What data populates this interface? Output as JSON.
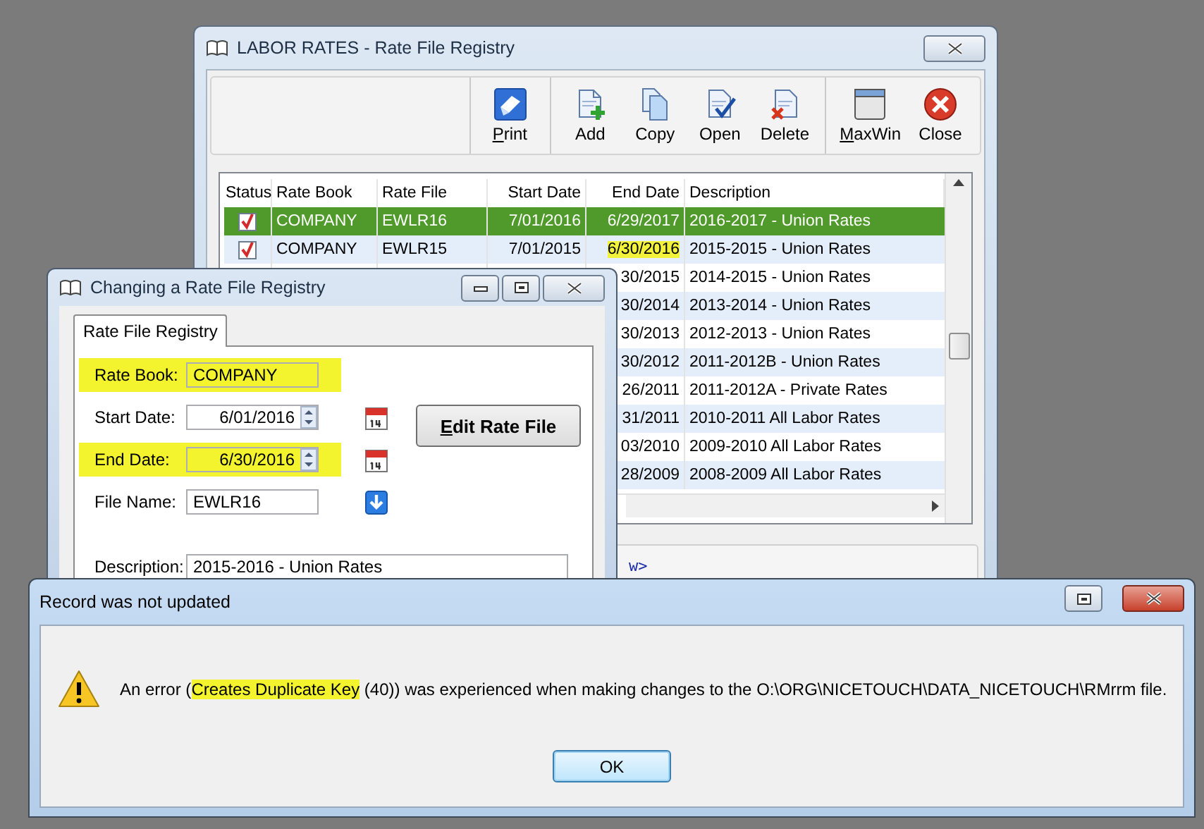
{
  "main_window": {
    "title": "LABOR RATES - Rate File Registry",
    "toolbar": [
      [
        {
          "label": "Print",
          "kind": "print",
          "mnemonic": true
        }
      ],
      [
        {
          "label": "Add",
          "kind": "add",
          "mnemonic": false
        },
        {
          "label": "Copy",
          "kind": "copy",
          "mnemonic": false
        },
        {
          "label": "Open",
          "kind": "open",
          "mnemonic": false
        },
        {
          "label": "Delete",
          "kind": "delete",
          "mnemonic": false
        }
      ],
      [
        {
          "label": "MaxWin",
          "kind": "maxwin",
          "mnemonic": true
        },
        {
          "label": "Close",
          "kind": "close",
          "mnemonic": false
        }
      ]
    ],
    "table": {
      "columns": [
        {
          "label": "Status",
          "kind": "status"
        },
        {
          "label": "Rate Book",
          "kind": "text"
        },
        {
          "label": "Rate File",
          "kind": "text"
        },
        {
          "label": "Start Date",
          "kind": "date"
        },
        {
          "label": "End Date",
          "kind": "date"
        },
        {
          "label": "Description",
          "kind": "text"
        }
      ],
      "rows": [
        {
          "selected": true,
          "checked": true,
          "rate_book": "COMPANY",
          "rate_file": "EWLR16",
          "start_date": "7/01/2016",
          "end_date": "6/29/2017",
          "end_date_highlighted": false,
          "description": "2016-2017 - Union Rates"
        },
        {
          "selected": false,
          "checked": true,
          "rate_book": "COMPANY",
          "rate_file": "EWLR15",
          "start_date": "7/01/2015",
          "end_date": "6/30/2016",
          "end_date_highlighted": true,
          "description": "2015-2015 - Union Rates"
        },
        {
          "selected": false,
          "end_date": "30/2015",
          "end_date_highlighted": false,
          "description": "2014-2015 - Union Rates"
        },
        {
          "selected": false,
          "end_date": "30/2014",
          "end_date_highlighted": false,
          "description": "2013-2014 - Union Rates"
        },
        {
          "selected": false,
          "end_date": "30/2013",
          "end_date_highlighted": false,
          "description": "2012-2013 - Union Rates"
        },
        {
          "selected": false,
          "end_date": "30/2012",
          "end_date_highlighted": false,
          "description": "2011-2012B - Union Rates"
        },
        {
          "selected": false,
          "end_date": "26/2011",
          "end_date_highlighted": false,
          "description": "2011-2012A - Private Rates"
        },
        {
          "selected": false,
          "end_date": "31/2011",
          "end_date_highlighted": false,
          "description": "2010-2011 All Labor Rates"
        },
        {
          "selected": false,
          "end_date": "03/2010",
          "end_date_highlighted": false,
          "description": "2009-2010 All Labor Rates"
        },
        {
          "selected": false,
          "end_date": "28/2009",
          "end_date_highlighted": false,
          "description": "2008-2009 All Labor Rates"
        }
      ]
    },
    "bottom_panel_text": "w>"
  },
  "edit_dialog": {
    "title": "Changing a Rate File Registry",
    "tabs": [
      {
        "label": "Rate File Registry",
        "selected": true
      }
    ],
    "fields": [
      {
        "label": "Rate Book:",
        "value": "COMPANY",
        "kind": "text",
        "highlighted": true
      },
      {
        "label": "Start Date:",
        "value": "6/01/2016",
        "kind": "date",
        "highlighted": false
      },
      {
        "label": "End Date:",
        "value": "6/30/2016",
        "kind": "date",
        "highlighted": true
      },
      {
        "label": "File Name:",
        "value": "EWLR16",
        "kind": "file",
        "highlighted": false
      },
      {
        "label": "Description:",
        "value": "2015-2016 - Union Rates",
        "kind": "wide",
        "highlighted": false
      }
    ],
    "button": {
      "label": "Edit Rate File",
      "mnemonic": true
    }
  },
  "message_box": {
    "title": "Record was not updated",
    "message": [
      {
        "text": "An error (",
        "highlighted": false
      },
      {
        "text": "Creates Duplicate Key",
        "highlighted": true
      },
      {
        "text": " (40)) was experienced when making changes to the O:\\ORG\\NICETOUCH\\DATA_NICETOUCH\\RMrrm file.",
        "highlighted": false
      }
    ],
    "button": "OK"
  }
}
